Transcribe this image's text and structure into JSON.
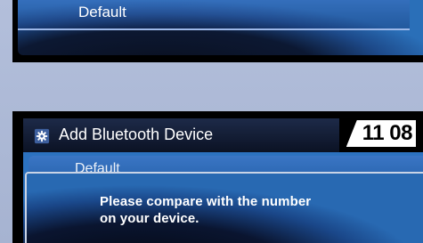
{
  "top_screen": {
    "selected_item_label": "Default"
  },
  "bottom_screen": {
    "header": {
      "title": "Add Bluetooth Device",
      "icon": "gear-icon",
      "clock": "11 08"
    },
    "list": {
      "partially_hidden_item": "Default"
    },
    "dialog": {
      "message_line1": "Please compare with the number",
      "message_line2": "on your device."
    }
  },
  "colors": {
    "screen_bezel": "#000000",
    "page_background": "#aab6d4",
    "highlight_blue": "#2a6fb8",
    "clock_badge": "#ffffff",
    "text": "#ffffff"
  }
}
